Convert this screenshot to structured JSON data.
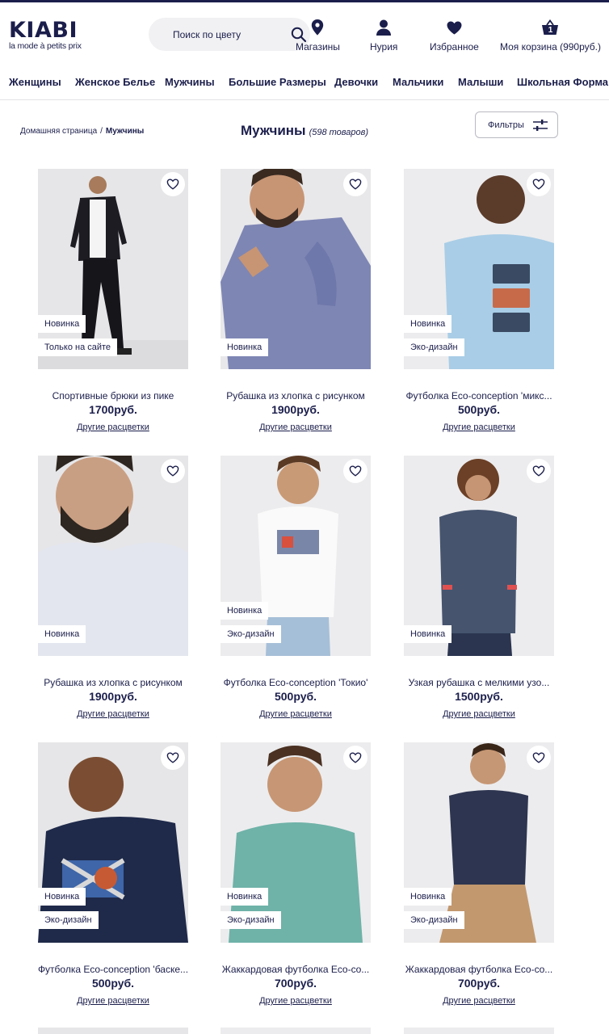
{
  "brand": {
    "name": "KIABI",
    "tagline": "la mode à petits prix"
  },
  "search": {
    "placeholder": "Поиск по цвету"
  },
  "header_actions": [
    {
      "label": "Магазины",
      "icon": "location-pin-icon"
    },
    {
      "label": "Нурия",
      "icon": "user-icon"
    },
    {
      "label": "Избранное",
      "icon": "heart-icon"
    },
    {
      "label": "Моя корзина (990руб.)",
      "icon": "basket-icon",
      "count": "1"
    }
  ],
  "nav": [
    "Женщины",
    "Женское Белье",
    "Мужчины",
    "Большие Размеры",
    "Девочки",
    "Мальчики",
    "Малыши",
    "Школьная Форма"
  ],
  "breadcrumb": {
    "home": "Домашняя страница",
    "separator": "/",
    "current": "Мужчины"
  },
  "page": {
    "title": "Мужчины",
    "count": "(598 товаров)"
  },
  "filters": {
    "label": "Фильтры"
  },
  "colors": {
    "brand": "#1b1e4b",
    "image_bg": "#e9e9ec"
  },
  "products": [
    {
      "name": "Спортивные брюки из пике",
      "price": "1700руб.",
      "link": "Другие расцветки",
      "badges": [
        "Новинка",
        "Только на сайте"
      ]
    },
    {
      "name": "Рубашка из хлопка с рисунком",
      "price": "1900руб.",
      "link": "Другие расцветки",
      "badges": [
        "Новинка"
      ]
    },
    {
      "name": "Футболка Eco-conception 'микс...",
      "price": "500руб.",
      "link": "Другие расцветки",
      "badges": [
        "Новинка",
        "Эко-дизайн"
      ]
    },
    {
      "name": "Рубашка из хлопка с рисунком",
      "price": "1900руб.",
      "link": "Другие расцветки",
      "badges": [
        "Новинка"
      ]
    },
    {
      "name": "Футболка Eco-conception 'Токио'",
      "price": "500руб.",
      "link": "Другие расцветки",
      "badges": [
        "Новинка",
        "Эко-дизайн"
      ]
    },
    {
      "name": "Узкая рубашка с мелкими узо...",
      "price": "1500руб.",
      "link": "Другие расцветки",
      "badges": [
        "Новинка"
      ]
    },
    {
      "name": "Футболка Eco-conception 'баске...",
      "price": "500руб.",
      "link": "Другие расцветки",
      "badges": [
        "Новинка",
        "Эко-дизайн"
      ]
    },
    {
      "name": "Жаккардовая футболка Eco-co...",
      "price": "700руб.",
      "link": "Другие расцветки",
      "badges": [
        "Новинка",
        "Эко-дизайн"
      ]
    },
    {
      "name": "Жаккардовая футболка Eco-co...",
      "price": "700руб.",
      "link": "Другие расцветки",
      "badges": [
        "Новинка",
        "Эко-дизайн"
      ]
    }
  ]
}
